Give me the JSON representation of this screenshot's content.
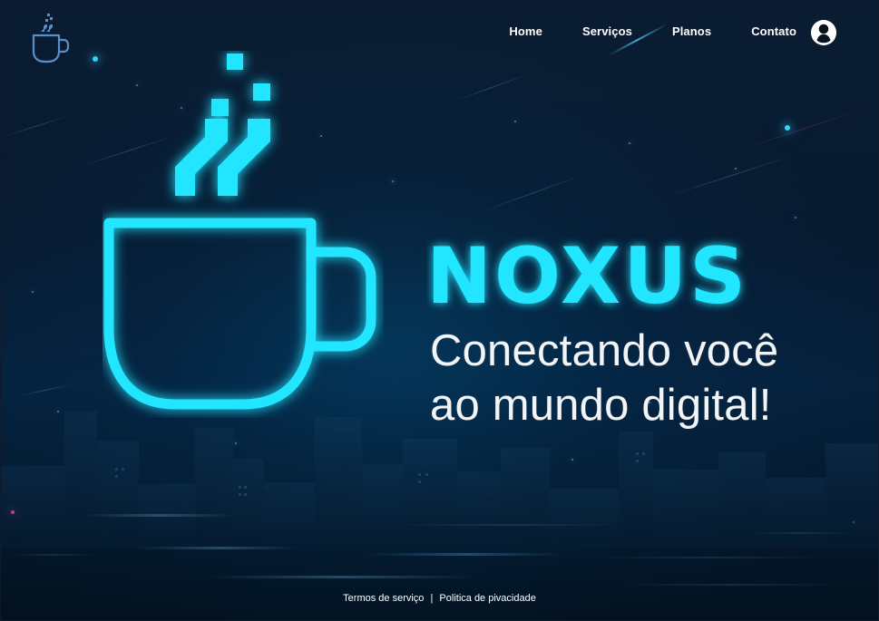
{
  "nav": {
    "items": [
      {
        "label": "Home"
      },
      {
        "label": "Serviços"
      },
      {
        "label": "Planos"
      },
      {
        "label": "Contato"
      }
    ]
  },
  "hero": {
    "brand": "NOXUS",
    "tagline_line_1": "Conectando você",
    "tagline_line_2": "ao mundo digital!"
  },
  "footer": {
    "terms": "Termos de serviço",
    "privacy": "Politica de pivacidade",
    "separator": "|"
  },
  "icons": {
    "logo": "coffee-cup-icon",
    "profile": "user-icon",
    "hero_mug": "coffee-cup-icon"
  },
  "colors": {
    "accent": "#22E6FF",
    "background": "#061426",
    "text": "#FFFFFF"
  }
}
